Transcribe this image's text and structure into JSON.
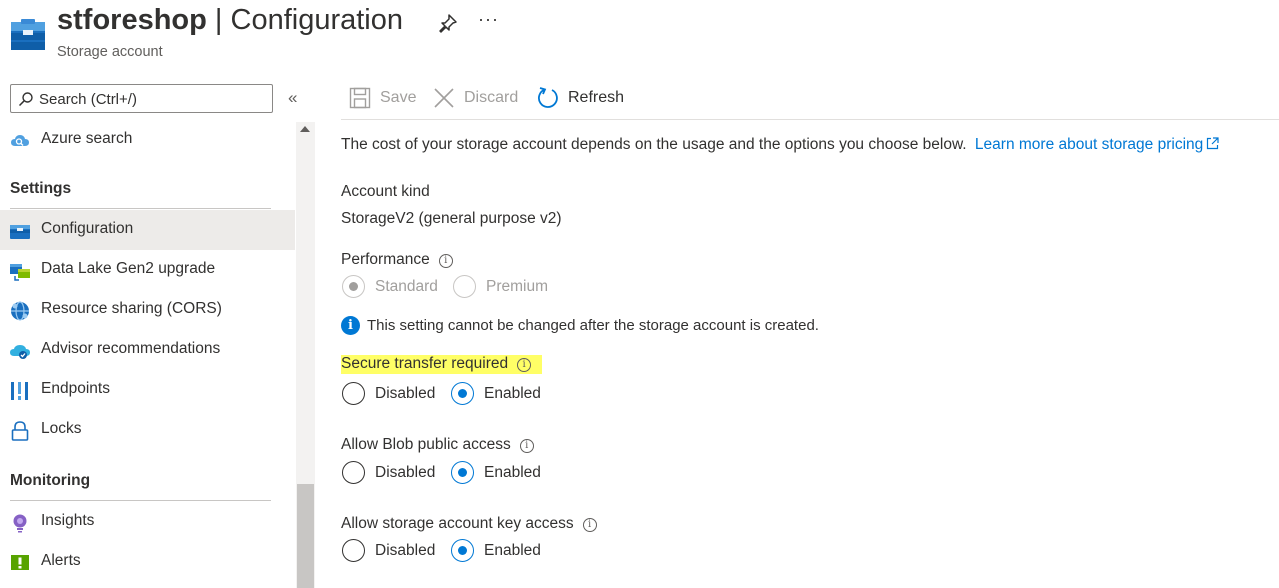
{
  "header": {
    "resource_name": "stforeshop",
    "title_separator": " | ",
    "page_name": "Configuration",
    "subtitle": "Storage account",
    "more_label": "···"
  },
  "sidebar": {
    "search_placeholder": "Search (Ctrl+/)",
    "collapse_label": "«",
    "items_top": [
      {
        "label": "Azure search",
        "icon": "cloud-search-icon"
      }
    ],
    "groups": [
      {
        "title": "Settings",
        "items": [
          {
            "label": "Configuration",
            "icon": "configuration-icon",
            "active": true
          },
          {
            "label": "Data Lake Gen2 upgrade",
            "icon": "data-lake-icon"
          },
          {
            "label": "Resource sharing (CORS)",
            "icon": "cors-icon"
          },
          {
            "label": "Advisor recommendations",
            "icon": "advisor-icon"
          },
          {
            "label": "Endpoints",
            "icon": "endpoints-icon"
          },
          {
            "label": "Locks",
            "icon": "lock-icon"
          }
        ]
      },
      {
        "title": "Monitoring",
        "items": [
          {
            "label": "Insights",
            "icon": "insights-icon"
          },
          {
            "label": "Alerts",
            "icon": "alerts-icon"
          }
        ]
      }
    ]
  },
  "toolbar": {
    "save_label": "Save",
    "discard_label": "Discard",
    "refresh_label": "Refresh"
  },
  "main": {
    "description": "The cost of your storage account depends on the usage and the options you choose below.",
    "pricing_link": "Learn more about storage pricing",
    "account_kind_label": "Account kind",
    "account_kind_value": "StorageV2 (general purpose v2)",
    "performance_label": "Performance",
    "performance_options": [
      "Standard",
      "Premium"
    ],
    "performance_selected": "Standard",
    "notice": "This setting cannot be changed after the storage account is created.",
    "secure_transfer_label": "Secure transfer required",
    "blob_public_label": "Allow Blob public access",
    "key_access_label": "Allow storage account key access",
    "option_disabled": "Disabled",
    "option_enabled": "Enabled",
    "secure_transfer_value": "Enabled",
    "blob_public_value": "Enabled",
    "key_access_value": "Enabled"
  },
  "colors": {
    "accent": "#0078d4",
    "highlight": "#ffff66",
    "active_nav_bg": "#edebe9"
  }
}
